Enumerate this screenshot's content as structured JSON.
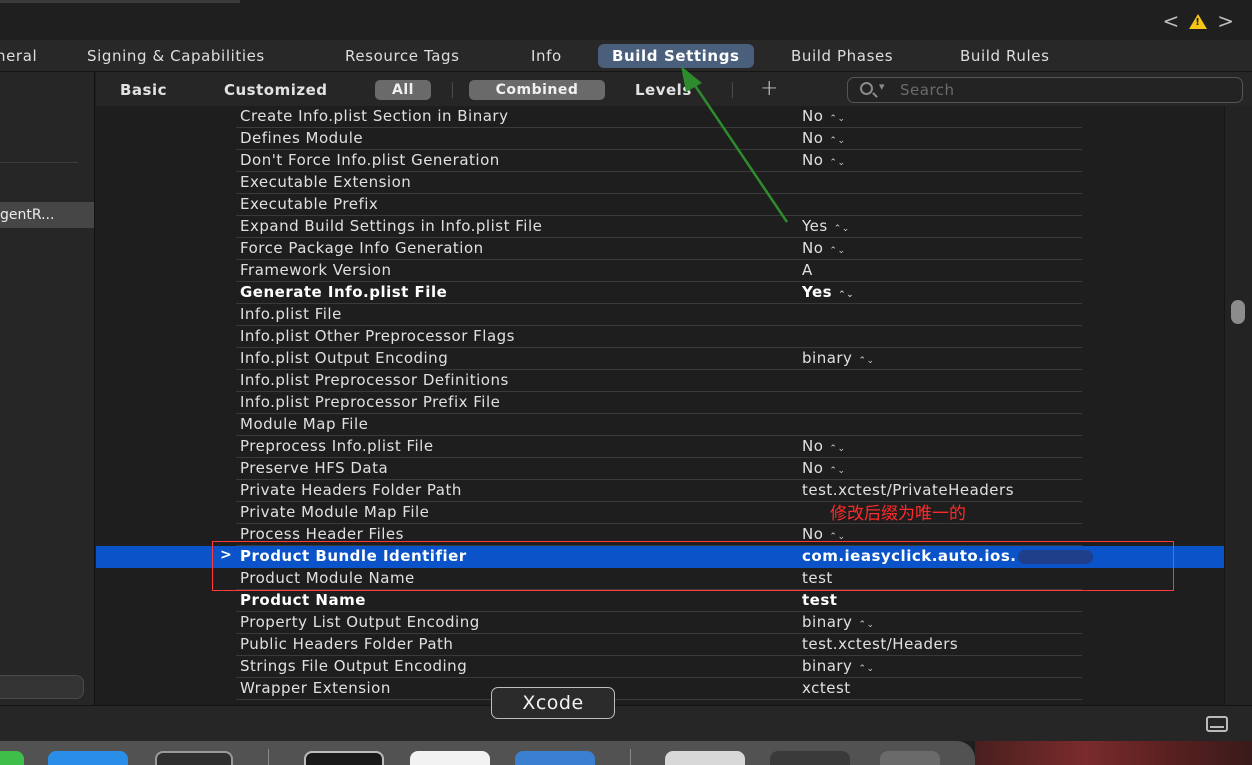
{
  "editor_tabs": [
    {
      "label": "neral"
    },
    {
      "label": "Signing & Capabilities"
    },
    {
      "label": "Resource Tags"
    },
    {
      "label": "Info"
    },
    {
      "label": "Build Settings"
    },
    {
      "label": "Build Phases"
    },
    {
      "label": "Build Rules"
    }
  ],
  "active_tab": "Build Settings",
  "nav": {
    "back": "<",
    "forward": ">",
    "warning": "!"
  },
  "sidebar": {
    "target_label": "gentR..."
  },
  "toolbar": {
    "basic": "Basic",
    "customized": "Customized",
    "all": "All",
    "combined": "Combined",
    "levels": "Levels",
    "add": "+",
    "search_placeholder": "Search"
  },
  "settings": [
    {
      "name": "Create Info.plist Section in Binary",
      "value": "No",
      "stepper": true,
      "bold": false
    },
    {
      "name": "Defines Module",
      "value": "No",
      "stepper": true,
      "bold": false
    },
    {
      "name": "Don't Force Info.plist Generation",
      "value": "No",
      "stepper": true,
      "bold": false
    },
    {
      "name": "Executable Extension",
      "value": "",
      "stepper": false,
      "bold": false
    },
    {
      "name": "Executable Prefix",
      "value": "",
      "stepper": false,
      "bold": false
    },
    {
      "name": "Expand Build Settings in Info.plist File",
      "value": "Yes",
      "stepper": true,
      "bold": false
    },
    {
      "name": "Force Package Info Generation",
      "value": "No",
      "stepper": true,
      "bold": false
    },
    {
      "name": "Framework Version",
      "value": "A",
      "stepper": false,
      "bold": false
    },
    {
      "name": "Generate Info.plist File",
      "value": "Yes",
      "stepper": true,
      "bold": true
    },
    {
      "name": "Info.plist File",
      "value": "",
      "stepper": false,
      "bold": false
    },
    {
      "name": "Info.plist Other Preprocessor Flags",
      "value": "",
      "stepper": false,
      "bold": false
    },
    {
      "name": "Info.plist Output Encoding",
      "value": "binary",
      "stepper": true,
      "bold": false
    },
    {
      "name": "Info.plist Preprocessor Definitions",
      "value": "",
      "stepper": false,
      "bold": false
    },
    {
      "name": "Info.plist Preprocessor Prefix File",
      "value": "",
      "stepper": false,
      "bold": false
    },
    {
      "name": "Module Map File",
      "value": "",
      "stepper": false,
      "bold": false
    },
    {
      "name": "Preprocess Info.plist File",
      "value": "No",
      "stepper": true,
      "bold": false
    },
    {
      "name": "Preserve HFS Data",
      "value": "No",
      "stepper": true,
      "bold": false
    },
    {
      "name": "Private Headers Folder Path",
      "value": "test.xctest/PrivateHeaders",
      "stepper": false,
      "bold": false
    },
    {
      "name": "Private Module Map File",
      "value": "",
      "stepper": false,
      "bold": false
    },
    {
      "name": "Process Header Files",
      "value": "No",
      "stepper": true,
      "bold": false
    },
    {
      "name": "Product Bundle Identifier",
      "value": "com.ieasyclick.auto.ios.",
      "stepper": false,
      "bold": true,
      "selected": true,
      "redacted": true
    },
    {
      "name": "Product Module Name",
      "value": "test",
      "stepper": false,
      "bold": false
    },
    {
      "name": "Product Name",
      "value": "test",
      "stepper": false,
      "bold": true
    },
    {
      "name": "Property List Output Encoding",
      "value": "binary",
      "stepper": true,
      "bold": false
    },
    {
      "name": "Public Headers Folder Path",
      "value": "test.xctest/Headers",
      "stepper": false,
      "bold": false
    },
    {
      "name": "Strings File Output Encoding",
      "value": "binary",
      "stepper": true,
      "bold": false
    },
    {
      "name": "Wrapper Extension",
      "value": "xctest",
      "stepper": false,
      "bold": false
    }
  ],
  "tooltip": "Xcode",
  "annotation": {
    "note": "修改后缀为唯一的",
    "color": "#ff2a2a",
    "arrow_color": "#2e8b2e"
  },
  "colors": {
    "selection": "#0a53c8",
    "active_tab": "#4a5f7c",
    "warning": "#f5c518"
  }
}
